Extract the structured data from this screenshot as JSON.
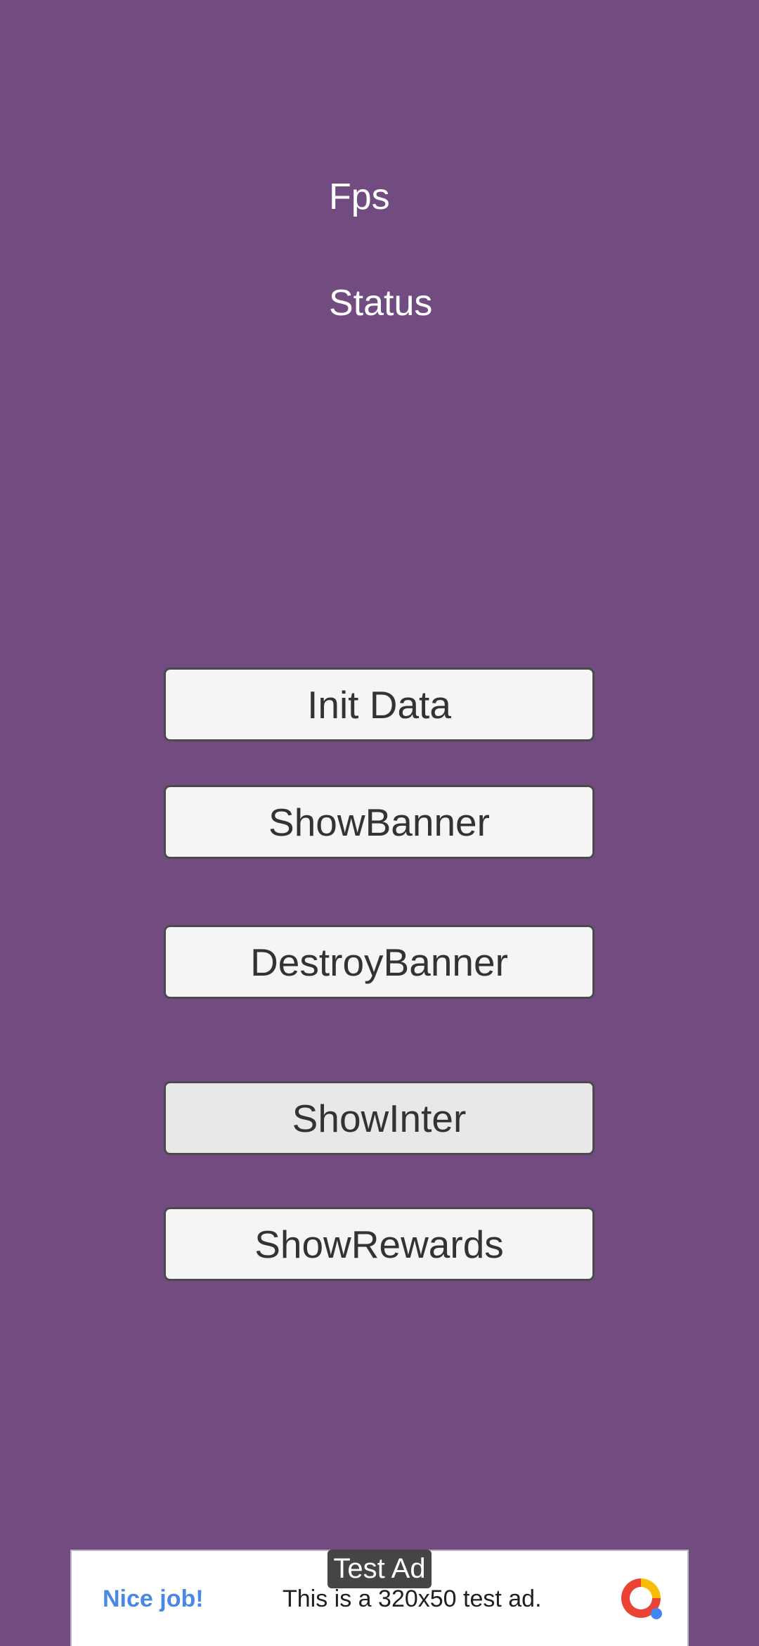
{
  "labels": {
    "fps": "Fps",
    "status": "Status"
  },
  "buttons": {
    "init_data": "Init Data",
    "show_banner": "ShowBanner",
    "destroy_banner": "DestroyBanner",
    "show_inter": "ShowInter",
    "show_rewards": "ShowRewards"
  },
  "ad": {
    "badge": "Test Ad",
    "headline": "Nice job!",
    "body": "This is a 320x50 test ad.",
    "logo_icon": "admob-logo-icon"
  },
  "colors": {
    "background": "#724c80",
    "button_bg": "#f5f5f5",
    "button_border": "#4a4a4a",
    "ad_headline": "#4a88e6"
  }
}
